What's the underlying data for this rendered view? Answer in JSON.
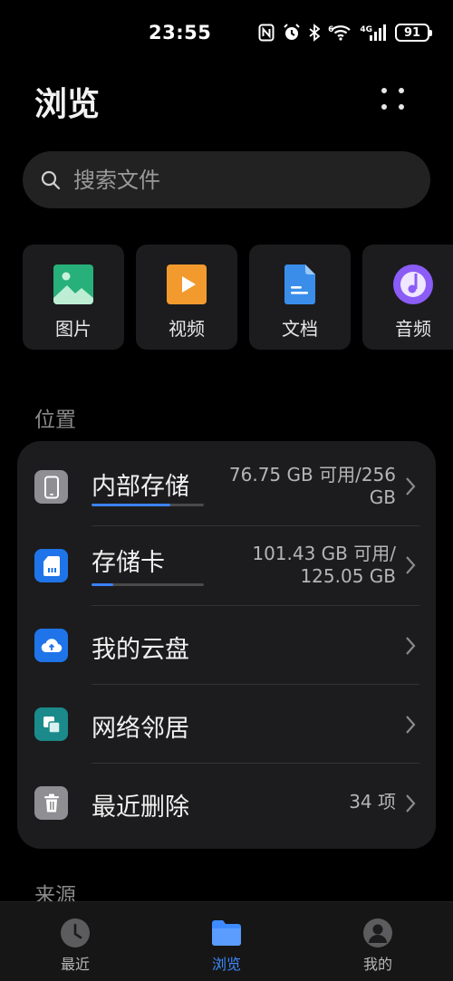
{
  "status_bar": {
    "time": "23:55",
    "network_type": "4G",
    "wifi_label": "6",
    "battery": "91",
    "icons": [
      "nfc-icon",
      "alarm-icon",
      "bluetooth-icon",
      "wifi-icon",
      "signal-icon",
      "battery-icon"
    ]
  },
  "header": {
    "title": "浏览"
  },
  "search": {
    "placeholder": "搜索文件"
  },
  "categories": [
    {
      "label": "图片",
      "icon": "image-icon",
      "color": "#27b07a"
    },
    {
      "label": "视频",
      "icon": "video-icon",
      "color": "#f29a2e"
    },
    {
      "label": "文档",
      "icon": "document-icon",
      "color": "#3a8eea"
    },
    {
      "label": "音频",
      "icon": "audio-icon",
      "color": "#8b5cf6"
    }
  ],
  "locations": {
    "section_title": "位置",
    "items": [
      {
        "name": "内部存储",
        "meta_line1": "76.75 GB 可用/256",
        "meta_line2": "GB",
        "icon": "phone-icon",
        "color": "#8e8e93",
        "usage_fraction": 0.7
      },
      {
        "name": "存储卡",
        "meta_line1": "101.43 GB 可用/",
        "meta_line2": "125.05 GB",
        "icon": "sd-card-icon",
        "color": "#1e74e8",
        "usage_fraction": 0.19
      },
      {
        "name": "我的云盘",
        "meta_line1": "",
        "meta_line2": "",
        "icon": "cloud-icon",
        "color": "#1e74e8"
      },
      {
        "name": "网络邻居",
        "meta_line1": "",
        "meta_line2": "",
        "icon": "network-neighbors-icon",
        "color": "#1a8a8a"
      },
      {
        "name": "最近删除",
        "meta_line1": "34 项",
        "meta_line2": "",
        "icon": "trash-icon",
        "color": "#8e8e93"
      }
    ]
  },
  "sources": {
    "section_title": "来源"
  },
  "bottom_nav": {
    "items": [
      {
        "label": "最近",
        "icon": "clock-icon",
        "active": false
      },
      {
        "label": "浏览",
        "icon": "folder-icon",
        "active": true
      },
      {
        "label": "我的",
        "icon": "profile-icon",
        "active": false
      }
    ],
    "active_color": "#3d8bff"
  }
}
